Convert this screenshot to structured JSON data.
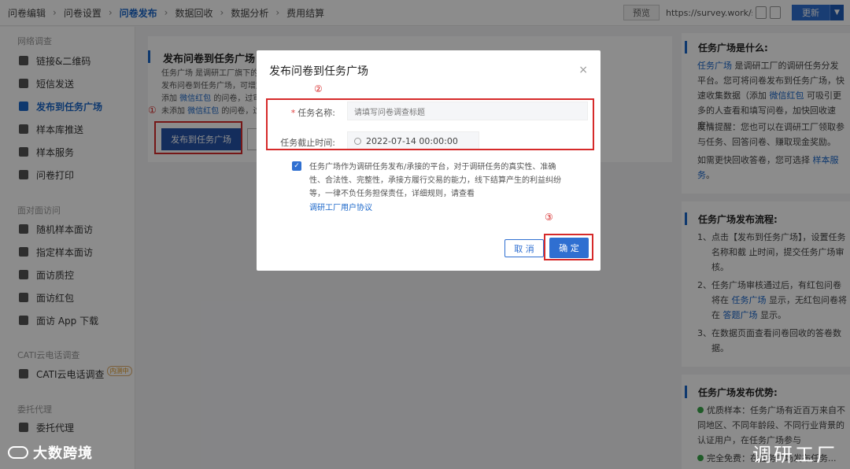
{
  "breadcrumb": [
    {
      "label": "问卷编辑"
    },
    {
      "label": "问卷设置"
    },
    {
      "label": "问卷发布"
    },
    {
      "label": "数据回收"
    },
    {
      "label": "数据分析"
    },
    {
      "label": "费用结算"
    }
  ],
  "top_right": {
    "preview_label": "预览",
    "url_text": "https://survey.work/s/",
    "update_label": "更新",
    "dropdown_glyph": "▼"
  },
  "sidebar": {
    "group1": "网络调查",
    "items1": [
      {
        "label": "链接&二维码",
        "icon": "link-icon"
      },
      {
        "label": "短信发送",
        "icon": "sms-icon"
      },
      {
        "label": "发布到任务广场",
        "icon": "send-icon"
      },
      {
        "label": "样本库推送",
        "icon": "sample-push-icon"
      },
      {
        "label": "样本服务",
        "icon": "sample-service-icon"
      },
      {
        "label": "问卷打印",
        "icon": "print-icon"
      }
    ],
    "group2": "面对面访问",
    "items2": [
      {
        "label": "随机样本面访",
        "icon": "random-sample-icon"
      },
      {
        "label": "指定样本面访",
        "icon": "assigned-sample-icon"
      },
      {
        "label": "面访质控",
        "icon": "shield-icon"
      },
      {
        "label": "面访红包",
        "icon": "red-packet-icon"
      },
      {
        "label": "面访 App 下载",
        "icon": "android-icon"
      }
    ],
    "group3": "CATI云电话调查",
    "items3": [
      {
        "label": "CATI云电话调查",
        "icon": "phone-icon",
        "tag": "内测中"
      }
    ],
    "group4": "委托代理",
    "items4": [
      {
        "label": "委托代理",
        "icon": "handshake-icon"
      }
    ]
  },
  "main": {
    "title": "发布问卷到任务广场",
    "intro_lines": [
      [
        "任务广场 是调研工厂旗下的任",
        ""
      ],
      [
        "发布问卷到任务广场，可增加",
        ""
      ],
      [
        "添加 ",
        "微信红包",
        " 的问卷，过审后"
      ],
      [
        "未添加 ",
        "微信红包",
        " 的问卷，过审"
      ]
    ],
    "publish_label": "发布到任务广场"
  },
  "right_panel": {
    "what_title": "任务广场是什么:",
    "what_text": [
      "任务广场",
      " 是调研工厂的调研任务分发平台。您可将问卷发布到任务广场，快速收集数据（添加 ",
      "微信红包",
      " 可吸引更多的人查看和填写问卷，加快回收速度）。"
    ],
    "tip_text": "友情提醒：您也可以在调研工厂领取参与任务、回答问卷、赚取现金奖励。",
    "faster_text": [
      "如需更快回收答卷，您可选择 ",
      "样本服务",
      "。"
    ],
    "flow_title": "任务广场发布流程:",
    "flow_steps": [
      {
        "num": "1、",
        "text": "点击【发布到任务广场】，设置任务名称和截 止时间，提交任务广场审核。"
      },
      {
        "num": "2、",
        "parts": [
          "任务广场审核通过后，有红包问卷将在 ",
          "任务广场",
          " 显示，无红包问卷将在 ",
          "答题广场",
          " 显示。"
        ]
      },
      {
        "num": "3、",
        "text": "在数据页面查看问卷回收的答卷数据。"
      }
    ],
    "adv_title": "任务广场发布优势:",
    "adv_items": [
      "优质样本：任务广场有近百万来自不同地区、不同年龄段、不同行业背景的认证用户，在任务广场参与",
      "完全免费：在任务广场发布任务..."
    ]
  },
  "modal": {
    "title": "发布问卷到任务广场",
    "close_glyph": "×",
    "required_mark": "*",
    "name_label": "任务名称:",
    "name_placeholder": "请填写问卷调查标题",
    "deadline_label": "任务截止时间:",
    "deadline_value": "2022-07-14 00:00:00",
    "agree_text": "任务广场作为调研任务发布/承接的平台，对于调研任务的真实性、准确性、合法性、完整性，承接方履行交易的能力，线下结算产生的利益纠纷等，一律不负任务担保责任，详细规则，请查看",
    "agree_link": "调研工厂用户协议",
    "cancel_label": "取 消",
    "ok_label": "确 定",
    "check_glyph": "✓"
  },
  "annotations": {
    "n1": "①",
    "n2": "②",
    "n3": "③"
  },
  "watermark": {
    "left": "大数跨境",
    "right": "调研工厂"
  }
}
